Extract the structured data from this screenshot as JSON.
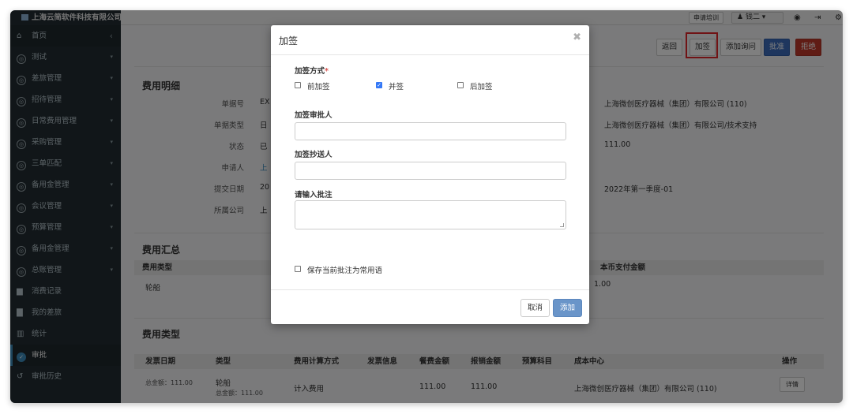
{
  "app": {
    "company": "上海云简软件科技有限公司"
  },
  "topbar": {
    "apply_training": "申请培训",
    "user_name": "钱二 ▾"
  },
  "sidebar": {
    "collapse": "‹",
    "items": [
      {
        "label": "首页",
        "icon": "home-icon",
        "glyph": "⌂",
        "caret": "‹"
      },
      {
        "label": "测试",
        "icon": "circle-icon",
        "glyph": "◎",
        "caret": "▾"
      },
      {
        "label": "差旅管理",
        "icon": "circle-icon",
        "glyph": "◎",
        "caret": "▾"
      },
      {
        "label": "招待管理",
        "icon": "circle-icon",
        "glyph": "◎",
        "caret": "▾"
      },
      {
        "label": "日常费用管理",
        "icon": "circle-icon",
        "glyph": "◎",
        "caret": "▾"
      },
      {
        "label": "采购管理",
        "icon": "circle-icon",
        "glyph": "◎",
        "caret": "▾"
      },
      {
        "label": "三单匹配",
        "icon": "circle-icon",
        "glyph": "◎",
        "caret": "▾"
      },
      {
        "label": "备用金管理",
        "icon": "circle-icon",
        "glyph": "◎",
        "caret": "▾"
      },
      {
        "label": "会议管理",
        "icon": "circle-icon",
        "glyph": "◎",
        "caret": "▾"
      },
      {
        "label": "预算管理",
        "icon": "circle-icon",
        "glyph": "◎",
        "caret": "▾"
      },
      {
        "label": "备用金管理",
        "icon": "circle-icon",
        "glyph": "◎",
        "caret": "▾"
      },
      {
        "label": "总账管理",
        "icon": "circle-icon",
        "glyph": "◎",
        "caret": "▾"
      },
      {
        "label": "消费记录",
        "icon": "document-icon",
        "glyph": "▆",
        "caret": ""
      },
      {
        "label": "我的差旅",
        "icon": "briefcase-icon",
        "glyph": "▇",
        "caret": ""
      },
      {
        "label": "统计",
        "icon": "bar-chart-icon",
        "glyph": "▥",
        "caret": ""
      },
      {
        "label": "审批",
        "icon": "check-circle-icon",
        "glyph": "✓",
        "caret": ""
      },
      {
        "label": "审批历史",
        "icon": "history-icon",
        "glyph": "↺",
        "caret": ""
      }
    ]
  },
  "actions": {
    "back": "返回",
    "add_sign": "加签",
    "add_inquiry": "添加询问",
    "approve": "批准",
    "reject": "拒绝"
  },
  "detail": {
    "title": "费用明细",
    "fields": [
      {
        "label": "单据号",
        "value": "EX"
      },
      {
        "label": "单据类型",
        "value": "日"
      },
      {
        "label": "状态",
        "value": "已"
      },
      {
        "label": "申请人",
        "value": "上"
      },
      {
        "label": "提交日期",
        "value": "20"
      },
      {
        "label": "所属公司",
        "value": "上"
      }
    ],
    "right_values": [
      "上海微创医疗器械（集团）有限公司 (110)",
      "上海微创医疗器械（集团）有限公司/技术支持",
      "111.00",
      "2022年第一季度-01"
    ]
  },
  "summary": {
    "title": "费用汇总",
    "col_type": "费用类型",
    "col_amount": "本币支付金额",
    "row_type": "轮船",
    "row_amount": "1.00"
  },
  "types": {
    "title": "费用类型",
    "headers": [
      "发票日期",
      "类型",
      "费用计算方式",
      "发票信息",
      "餐费金额",
      "报销金额",
      "预算科目",
      "成本中心",
      "操作"
    ],
    "row": {
      "total": "总金额：111.00",
      "type": "轮船",
      "type_sub": "总金额：111.00",
      "calc": "计入费用",
      "meal": "111.00",
      "reimburse": "111.00",
      "cost_center": "上海微创医疗器械（集团）有限公司 (110)",
      "action": "详情"
    }
  },
  "modal": {
    "title": "加签",
    "close": "✖",
    "method_label": "加签方式",
    "required_mark": "*",
    "options": [
      {
        "label": "前加签",
        "checked": false
      },
      {
        "label": "并签",
        "checked": true
      },
      {
        "label": "后加签",
        "checked": false
      }
    ],
    "approver_label": "加签审批人",
    "cc_label": "加签抄送人",
    "comment_label": "请输入批注",
    "save_common": "保存当前批注为常用语",
    "cancel": "取消",
    "add": "添加"
  }
}
